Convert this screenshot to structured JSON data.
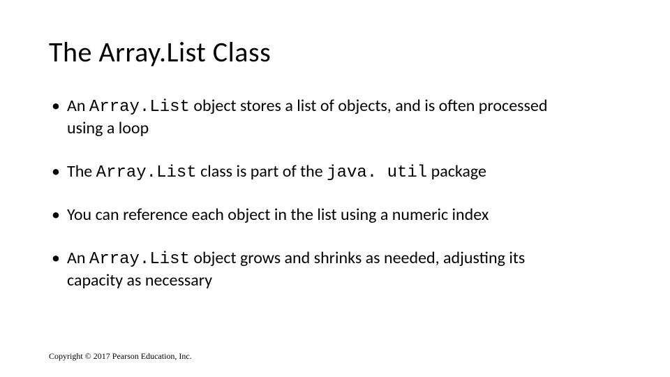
{
  "slide": {
    "title": "The Array.List Class",
    "bullets": [
      {
        "pre": "An ",
        "code1": "Array.List",
        "mid": " object stores a list of objects, and is often processed using a loop",
        "code2": "",
        "post": ""
      },
      {
        "pre": "The ",
        "code1": "Array.List",
        "mid": " class is part of the ",
        "code2": "java. util",
        "post": " package"
      },
      {
        "pre": "You can reference each object in the list using a numeric index",
        "code1": "",
        "mid": "",
        "code2": "",
        "post": ""
      },
      {
        "pre": "An ",
        "code1": "Array.List",
        "mid": " object grows and shrinks as needed, adjusting its capacity as necessary",
        "code2": "",
        "post": ""
      }
    ],
    "footer": "Copyright © 2017 Pearson Education, Inc."
  }
}
